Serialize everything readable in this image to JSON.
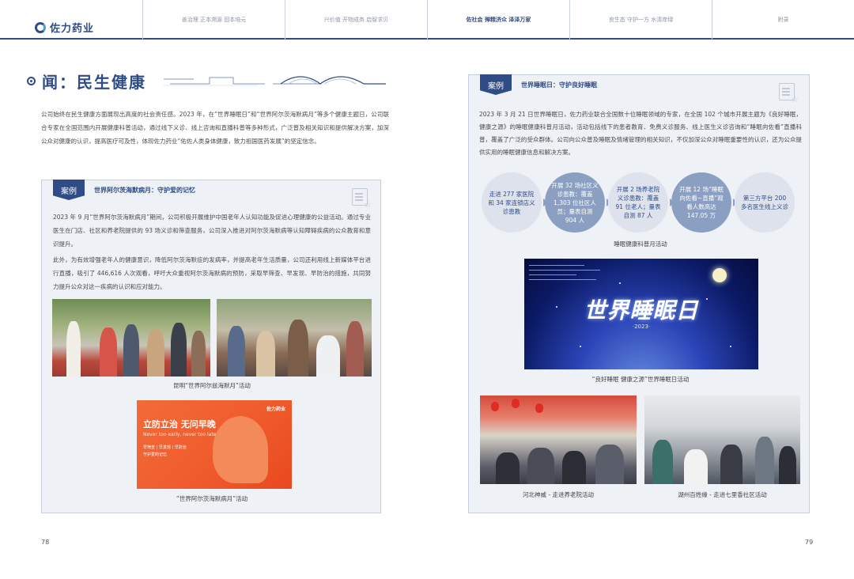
{
  "nav": {
    "brand": "佐力药业",
    "items": [
      "善治理 正本溯源 固本培元",
      "兴价值 开物成务 启智求贝",
      "佐社会 殚精济众 泽泽万家",
      "良生态 守护一方 水清岸绿",
      "附录"
    ],
    "active_index": 2
  },
  "left": {
    "section_title": "闻：民生健康",
    "intro": "公司始终在民生健康方面展现出高度的社会责任感。2023 年，在“世界睡眠日”和“世界阿尔茨海默病月”等多个健康主题日，公司联合专家在全国范围内开展健康科普活动，通过线下义诊、线上咨询和直播科普等多种形式，广泛普及相关知识和提供解决方案，加深公众对健康的认识，提高医疗可及性，体现佐力药业“佑佐人类身体健康，致力祖国医药发展”的坚定信念。",
    "case": {
      "tag": "案例",
      "title": "世界阿尔茨海默病月：守护爱的记忆",
      "p1": "2023 年 9 月“世界阿尔茨海默病月”期间，公司积极开展维护中国老年人认知功能及促进心理健康的公益活动。通过专业医生在门店、社区和养老院提供的 93 场义诊和筛查服务，公司深入推进对阿尔茨海默病等认知障碍疾病的公众教育和意识提升。",
      "p2": "此外，为有效增强老年人的健康意识，降低阿尔茨海默症的发病率，并提高老年生活质量，公司还利用线上新媒体平台进行直播，吸引了 446,616 人次观看，呼吁大众重视阿尔茨海默病的预防，采取早筛查、早发现、早防治的措施，共同努力提升公众对这一疾病的认识和应对能力。",
      "caption1": "昆明“世界阿尔兹海默月”活动",
      "caption2": "“世界阿尔茨海默病月”活动",
      "poster": {
        "logo": "佐力药业",
        "title": "立防立治 无问早晚",
        "subtitle": "Never too early, never too late",
        "line1": "早筛查 | 早发现 | 早防治",
        "line2": "守护爱的记忆"
      }
    },
    "page_number": "78"
  },
  "right": {
    "case": {
      "tag": "案例",
      "title": "世界睡眠日：守护良好睡眠",
      "intro": "2023 年 3 月 21 日世界睡眠日，佐力药业联合全国数十位睡眠领域的专家，在全国 102 个城市开展主题为《良好睡眠，健康之源》的睡眠健康科普月活动，活动包括线下的患者教育、免费义诊服务、线上医生义诊咨询和“睡眠向佐看”直播科普，覆盖了广泛的受众群体。公司向公众普及睡眠及情绪管理的相关知识，不仅加深公众对睡眠重要性的认识，还为公众提供实用的睡眠健康信息和解决方案。",
      "circles": [
        "走进 277 家医院和 34 家连锁店义诊患教",
        "开展 32 场社区义诊患教：覆盖 1,303 位社区人员；量表自测 904 人",
        "开展 2 场养老院义诊患教：覆盖 91 位老人；量表自测 87 人",
        "开展 12 场“睡眠向佐看~直播”观看人数高达 147.05 万",
        "第三方平台 200 多名医生线上义诊"
      ],
      "circles_caption": "睡眠健康科普月活动",
      "banner_title": "世界睡眠日",
      "banner_year": "·2023·",
      "banner_caption": "“良好睡眠 健康之源”世界睡眠日活动",
      "caption3": "河北神威 - 走进养老院活动",
      "caption4": "湖州百姓缘 - 走进七里香社区活动"
    },
    "page_number": "79"
  },
  "colors": {
    "primary": "#2f4c86",
    "case_bg": "#eef1f6",
    "circle_dark": "#8a9fc1",
    "circle_light": "#dde2ec",
    "poster_orange": "#ef5a2b"
  }
}
